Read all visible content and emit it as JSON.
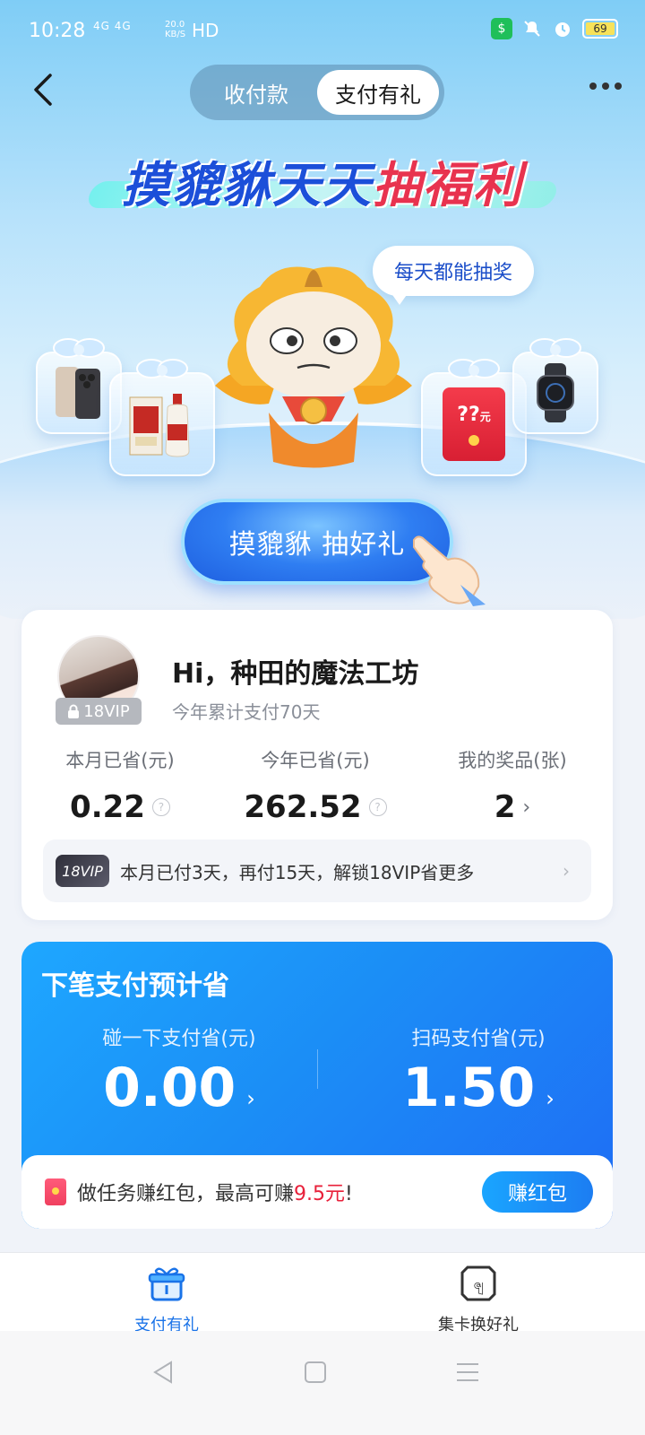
{
  "status_bar": {
    "time": "10:28",
    "network": "4G 4G",
    "speed": "20.0 KB/S",
    "hd": "HD",
    "battery": "69"
  },
  "header": {
    "tabs": [
      {
        "label": "收付款",
        "active": false
      },
      {
        "label": "支付有礼",
        "active": true
      }
    ]
  },
  "hero": {
    "title_part1": "摸貔貅天天",
    "title_part2": "抽福利",
    "bubble_text": "每天都能抽奖",
    "red_packet_text": "??",
    "red_packet_unit": "元",
    "cta_label": "摸貔貅 抽好礼"
  },
  "user": {
    "greeting": "Hi，种田的魔法工坊",
    "pay_days": "今年累计支付70天",
    "vip_level": "18VIP",
    "stats": [
      {
        "label": "本月已省(元)",
        "value": "0.22",
        "icon": "help-icon"
      },
      {
        "label": "今年已省(元)",
        "value": "262.52",
        "icon": "help-icon"
      },
      {
        "label": "我的奖品(张)",
        "value": "2",
        "icon": "chevron-right-icon"
      }
    ],
    "vip_banner": {
      "badge": "18VIP",
      "text": "本月已付3天，再付15天，解锁18VIP省更多"
    }
  },
  "savings": {
    "title": "下笔支付预计省",
    "columns": [
      {
        "label": "碰一下支付省(元)",
        "value": "0.00"
      },
      {
        "label": "扫码支付省(元)",
        "value": "1.50"
      }
    ],
    "task": {
      "text_before": "做任务赚红包，最高可赚",
      "amount": "9.5元",
      "text_after": "!",
      "button": "赚红包"
    }
  },
  "bottom_nav": {
    "items": [
      {
        "label": "支付有礼",
        "icon": "gift-icon",
        "active": true
      },
      {
        "label": "集卡换好礼",
        "icon": "card-icon",
        "active": false
      }
    ]
  },
  "colors": {
    "accent": "#1a73e8",
    "title_blue": "#1c4fd9",
    "title_red": "#e8334f",
    "highlight_red": "#e8203a"
  }
}
